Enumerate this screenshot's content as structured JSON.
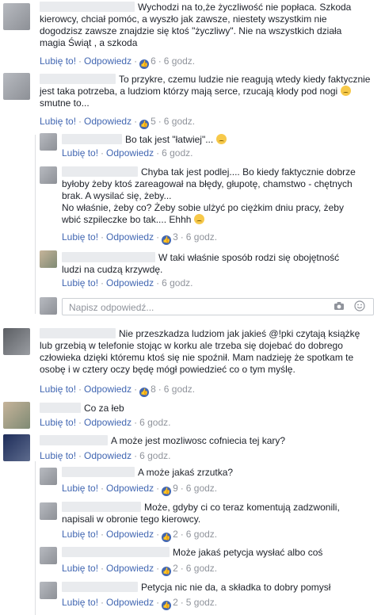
{
  "actions": {
    "like": "Lubię to!",
    "reply": "Odpowiedz",
    "sep": "·"
  },
  "comments": [
    {
      "lines": [
        "Wychodzi na to,że życzliwość nie popłaca. Szkoda",
        "kierowcy, chciał pomóc, a wyszło jak zawsze, niestety wszystkim nie",
        "dogodzisz zawsze znajdzie się ktoś \"życzliwy\". Nie na wszystkich działa",
        "magia Świąt , a szkoda"
      ],
      "likes": "6",
      "time": "6 godz."
    },
    {
      "lines": [
        "To przykre, czemu ludzie nie reagują wtedy kiedy faktycznie",
        "jest taka potrzeba, a ludziom którzy mają serce, rzucają kłody pod nogi",
        "smutne to..."
      ],
      "likes": "5",
      "time": "6 godz."
    },
    {
      "lines": [
        "Bo tak jest \"łatwiej\"..."
      ],
      "likes": "",
      "time": "6 godz."
    },
    {
      "lines": [
        "Chyba tak jest podlej.... Bo kiedy faktycznie dobrze",
        "byłoby żeby ktoś zareagował na błędy, głupotę, chamstwo - chętnych",
        "brak. A wysilać się, żeby...",
        "No właśnie, żeby co? Żeby sobie ulżyć po ciężkim dniu pracy, żeby",
        "wbić szpileczke bo tak.... Ehhh"
      ],
      "likes": "3",
      "time": "6 godz."
    },
    {
      "lines": [
        "W taki właśnie sposób rodzi się obojętność",
        "ludzi na cudzą krzywdę."
      ],
      "likes": "",
      "time": "6 godz."
    },
    {
      "lines": [
        "Nie przeszkadza ludziom jak jakieś @!pki czytają książkę",
        "lub grzebią w telefonie stojąc w korku ale trzeba się dojebać do dobrego",
        "człowieka dzięki któremu ktoś się nie spoźnił. Mam nadzieję że spotkam te",
        "osobę i w cztery oczy będę mógł powiedzieć co o tym myślę."
      ],
      "likes": "8",
      "time": "6 godz."
    },
    {
      "lines": [
        "Co za łeb"
      ],
      "likes": "",
      "time": "6 godz."
    },
    {
      "lines": [
        "A może jest mozliwosc cofniecia tej kary?"
      ],
      "likes": "",
      "time": "6 godz."
    },
    {
      "lines": [
        "A może jakaś zrzutka?"
      ],
      "likes": "9",
      "time": "6 godz."
    },
    {
      "lines": [
        "Może, gdyby ci co teraz komentują zadzwonili,",
        "napisali w obronie tego kierowcy."
      ],
      "likes": "2",
      "time": "6 godz."
    },
    {
      "lines": [
        "Może jakaś petycja wysłać albo coś"
      ],
      "likes": "2",
      "time": "6 godz."
    },
    {
      "lines": [
        "Petycja nic nie da, a składka to dobry pomysł"
      ],
      "likes": "2",
      "time": "5 godz."
    }
  ],
  "reply_box": {
    "placeholder": "Napisz odpowiedź..."
  },
  "icons": {
    "like": "thumbs-up-icon",
    "camera": "camera-icon",
    "emoji": "smiley-icon",
    "sad": "sad-emoji-icon"
  },
  "colors": {
    "link": "#4267b2",
    "muted": "#90949c",
    "text": "#1d2129"
  }
}
